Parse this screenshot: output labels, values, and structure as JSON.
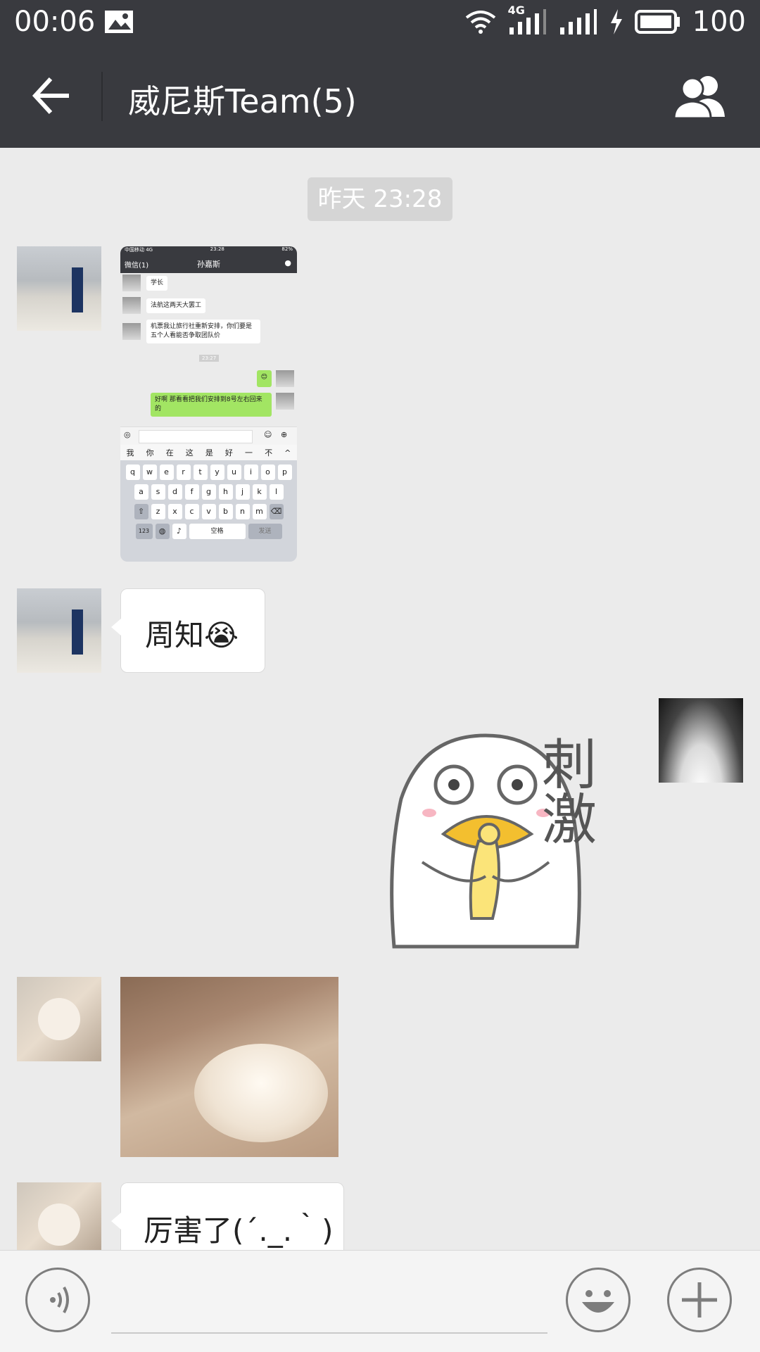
{
  "status_bar": {
    "time": "00:06",
    "network": "4G",
    "battery": "100"
  },
  "header": {
    "title": "威尼斯Team(5)"
  },
  "chat": {
    "timestamp": "昨天 23:28",
    "messages": [
      {
        "sender": "person-avatar",
        "type": "image",
        "screenshot": {
          "status_carrier": "中国移动 4G",
          "status_time": "23:28",
          "status_battery": "82%",
          "back_label": "微信(1)",
          "title": "孙嘉斯",
          "items": [
            {
              "side": "left",
              "text": "学长"
            },
            {
              "side": "left",
              "text": "法航这两天大罢工"
            },
            {
              "side": "left",
              "text": "机票我让旅行社重新安排，你们要是五个人看能否争取团队价"
            },
            {
              "side": "time",
              "text": "23:27"
            },
            {
              "side": "right",
              "text": "😊"
            },
            {
              "side": "right",
              "text": "好啊 那看看把我们安排到8号左右回来的"
            }
          ],
          "candidates": [
            "我",
            "你",
            "在",
            "这",
            "是",
            "好",
            "一",
            "不",
            "^"
          ],
          "keyboard_rows": [
            [
              "q",
              "w",
              "e",
              "r",
              "t",
              "y",
              "u",
              "i",
              "o",
              "p"
            ],
            [
              "a",
              "s",
              "d",
              "f",
              "g",
              "h",
              "j",
              "k",
              "l"
            ],
            [
              "z",
              "x",
              "c",
              "v",
              "b",
              "n",
              "m"
            ]
          ],
          "key_123": "123",
          "key_space": "空格",
          "key_send": "发送"
        }
      },
      {
        "sender": "person-avatar",
        "type": "text",
        "text": "周知😭"
      },
      {
        "sender": "self",
        "type": "sticker",
        "sticker_text": "刺激"
      },
      {
        "sender": "cat-avatar",
        "type": "image"
      },
      {
        "sender": "cat-avatar",
        "type": "text",
        "text": "厉害了(´._.｀)"
      }
    ]
  },
  "colors": {
    "titlebar": "#393a3f",
    "background": "#ebebeb",
    "bubble": "#ffffff",
    "own_bubble": "#a2e563"
  },
  "icons": [
    "back-arrow-icon",
    "group-members-icon",
    "voice-icon",
    "emoji-icon",
    "plus-icon",
    "wifi-icon",
    "signal-icon",
    "battery-icon",
    "charging-icon",
    "gallery-icon"
  ]
}
